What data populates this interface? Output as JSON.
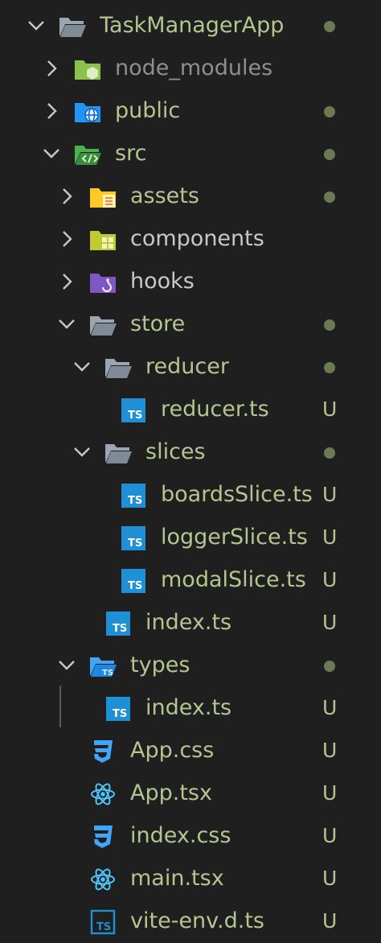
{
  "explorer": {
    "items": [
      {
        "label": "TaskManagerApp",
        "icon": "folder-open-icon",
        "chevron": "down",
        "depth": 0,
        "decoration": "dot",
        "labelStyle": "green"
      },
      {
        "label": "node_modules",
        "icon": "node-folder-icon",
        "chevron": "right",
        "depth": 1,
        "decoration": "none",
        "labelStyle": "dim"
      },
      {
        "label": "public",
        "icon": "globe-folder-icon",
        "chevron": "right",
        "depth": 1,
        "decoration": "dot",
        "labelStyle": "green"
      },
      {
        "label": "src",
        "icon": "source-folder-icon",
        "chevron": "down",
        "depth": 1,
        "decoration": "dot",
        "labelStyle": "green"
      },
      {
        "label": "assets",
        "icon": "assets-folder-icon",
        "chevron": "right",
        "depth": 2,
        "decoration": "dot",
        "labelStyle": "green"
      },
      {
        "label": "components",
        "icon": "components-folder-icon",
        "chevron": "right",
        "depth": 2,
        "decoration": "none",
        "labelStyle": "plain"
      },
      {
        "label": "hooks",
        "icon": "hooks-folder-icon",
        "chevron": "right",
        "depth": 2,
        "decoration": "none",
        "labelStyle": "plain"
      },
      {
        "label": "store",
        "icon": "folder-open-icon",
        "chevron": "down",
        "depth": 2,
        "decoration": "dot",
        "labelStyle": "green"
      },
      {
        "label": "reducer",
        "icon": "folder-open-icon",
        "chevron": "down",
        "depth": 3,
        "decoration": "dot",
        "labelStyle": "green"
      },
      {
        "label": "reducer.ts",
        "icon": "typescript-icon",
        "chevron": "none",
        "depth": 4,
        "decoration": "U",
        "labelStyle": "green"
      },
      {
        "label": "slices",
        "icon": "folder-open-icon",
        "chevron": "down",
        "depth": 3,
        "decoration": "dot",
        "labelStyle": "green"
      },
      {
        "label": "boardsSlice.ts",
        "icon": "typescript-icon",
        "chevron": "none",
        "depth": 4,
        "decoration": "U",
        "labelStyle": "green"
      },
      {
        "label": "loggerSlice.ts",
        "icon": "typescript-icon",
        "chevron": "none",
        "depth": 4,
        "decoration": "U",
        "labelStyle": "green"
      },
      {
        "label": "modalSlice.ts",
        "icon": "typescript-icon",
        "chevron": "none",
        "depth": 4,
        "decoration": "U",
        "labelStyle": "green"
      },
      {
        "label": "index.ts",
        "icon": "typescript-icon",
        "chevron": "none",
        "depth": 3,
        "decoration": "U",
        "labelStyle": "green"
      },
      {
        "label": "types",
        "icon": "types-folder-icon",
        "chevron": "down",
        "depth": 2,
        "decoration": "dot",
        "labelStyle": "green"
      },
      {
        "label": "index.ts",
        "icon": "typescript-icon",
        "chevron": "none",
        "depth": 3,
        "decoration": "U",
        "labelStyle": "green"
      },
      {
        "label": "App.css",
        "icon": "css-icon",
        "chevron": "none",
        "depth": 2,
        "decoration": "U",
        "labelStyle": "green"
      },
      {
        "label": "App.tsx",
        "icon": "react-icon",
        "chevron": "none",
        "depth": 2,
        "decoration": "U",
        "labelStyle": "green"
      },
      {
        "label": "index.css",
        "icon": "css-icon",
        "chevron": "none",
        "depth": 2,
        "decoration": "U",
        "labelStyle": "green"
      },
      {
        "label": "main.tsx",
        "icon": "react-icon",
        "chevron": "none",
        "depth": 2,
        "decoration": "U",
        "labelStyle": "green"
      },
      {
        "label": "vite-env.d.ts",
        "icon": "typescript-outline-icon",
        "chevron": "none",
        "depth": 2,
        "decoration": "U",
        "labelStyle": "green"
      }
    ]
  }
}
